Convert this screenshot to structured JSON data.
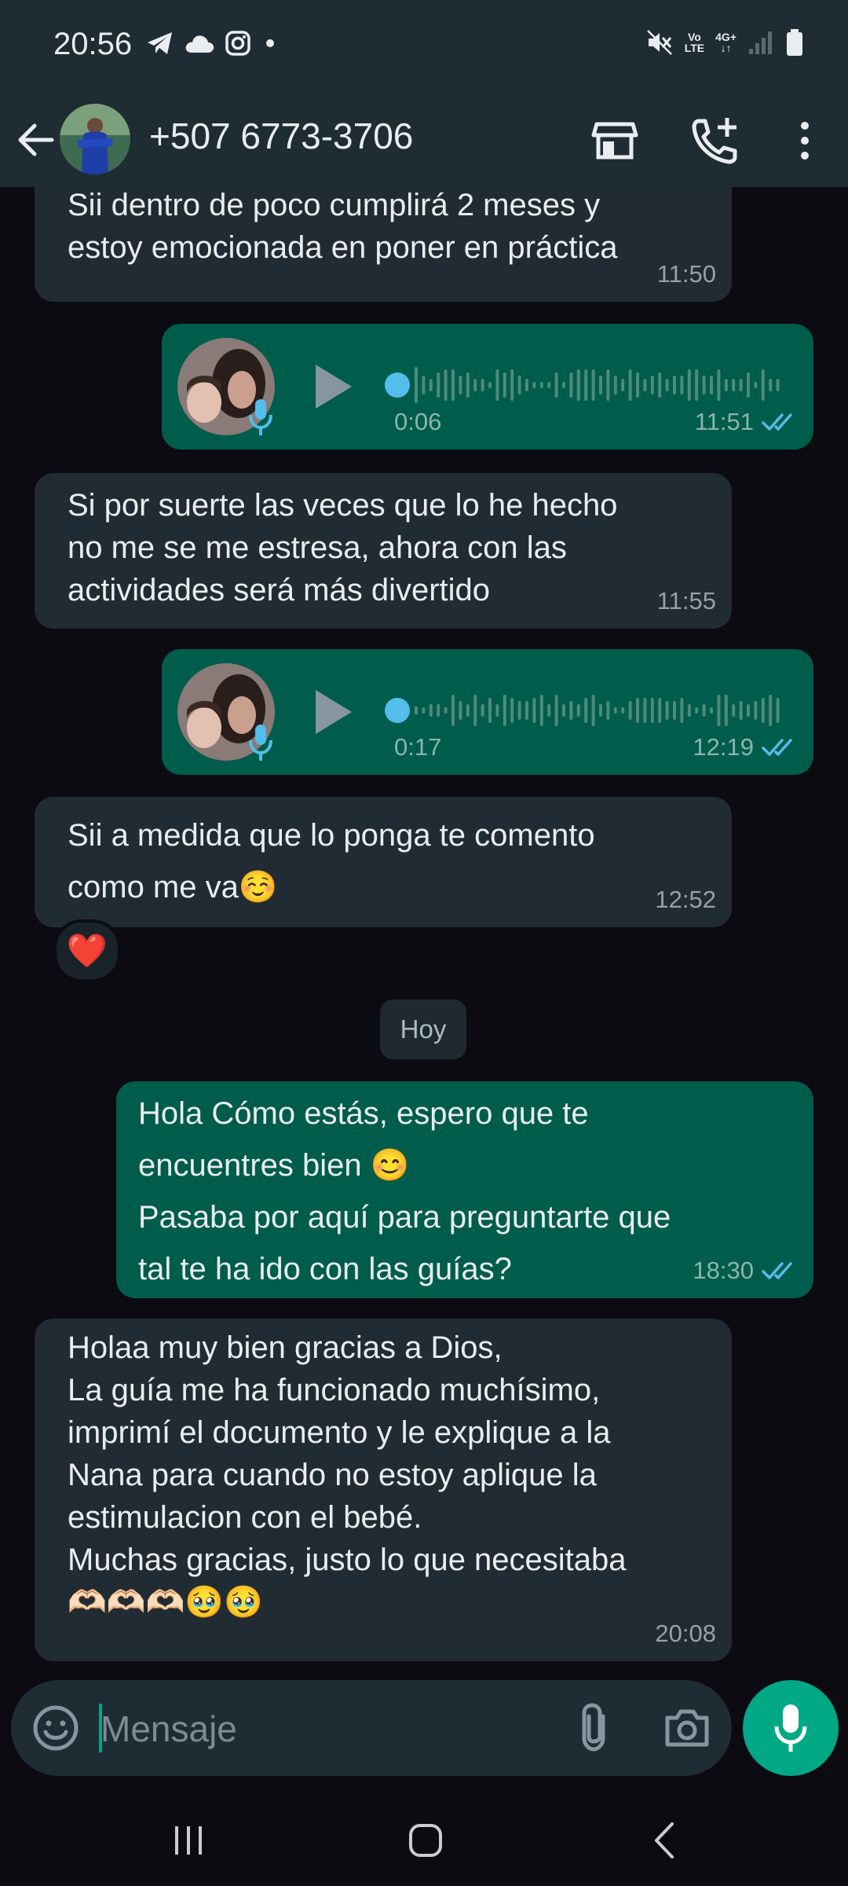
{
  "status_bar": {
    "time": "20:56",
    "network_top": "Vo",
    "network_bottom": "LTE",
    "cell_type": "4G+",
    "icons": [
      "telegram-icon",
      "cloud-icon",
      "instagram-icon",
      "dot-icon",
      "mute-icon",
      "signal-icon",
      "battery-icon"
    ]
  },
  "header": {
    "contact_name": "+507 6773-3706",
    "icons": [
      "back-arrow-icon",
      "store-icon",
      "add-call-icon",
      "more-vert-icon"
    ]
  },
  "messages": [
    {
      "type": "text",
      "direction": "in",
      "text": "Sii dentro de poco cumplirá 2 meses y\nestoy emocionada en poner en práctica",
      "time": "11:50"
    },
    {
      "type": "voice",
      "direction": "out",
      "duration": "0:06",
      "time": "11:51",
      "status": "read"
    },
    {
      "type": "text",
      "direction": "in",
      "text": "Si por suerte las veces que lo he hecho\nno me se me estresa, ahora con las\nactividades será más divertido",
      "time": "11:55"
    },
    {
      "type": "voice",
      "direction": "out",
      "duration": "0:17",
      "time": "12:19",
      "status": "read"
    },
    {
      "type": "text",
      "direction": "in",
      "text": "Sii a medida que lo ponga te comento\ncomo me va☺️",
      "time": "12:52",
      "reaction": "❤️"
    },
    {
      "type": "date_chip",
      "text": "Hoy"
    },
    {
      "type": "text",
      "direction": "out",
      "text": "Hola Cómo estás, espero que te\nencuentres bien 😊\nPasaba por aquí para preguntarte que\ntal te ha ido con las guías?",
      "time": "18:30",
      "status": "read"
    },
    {
      "type": "text",
      "direction": "in",
      "text": "Holaa muy bien gracias a Dios,\nLa guía me ha funcionado muchísimo,\nimprimí el documento y le explique a la\nNana para cuando no estoy aplique la\nestimulacion con el bebé.\nMuchas gracias, justo lo que necesitaba\n🫶🏻🫶🏻🫶🏻🥹🥹",
      "time": "20:08"
    }
  ],
  "composer": {
    "placeholder": "Mensaje",
    "value": "",
    "icons": [
      "emoji-icon",
      "attach-icon",
      "camera-icon",
      "mic-icon"
    ]
  },
  "nav_bar": {
    "icons": [
      "recent-apps-icon",
      "home-icon",
      "back-icon"
    ]
  },
  "colors": {
    "background": "#0c0b12",
    "bar": "#1f2c34",
    "incoming_bubble": "#212b34",
    "outgoing_bubble": "#005c4b",
    "accent": "#00a884",
    "read_ticks": "#53bdeb"
  }
}
